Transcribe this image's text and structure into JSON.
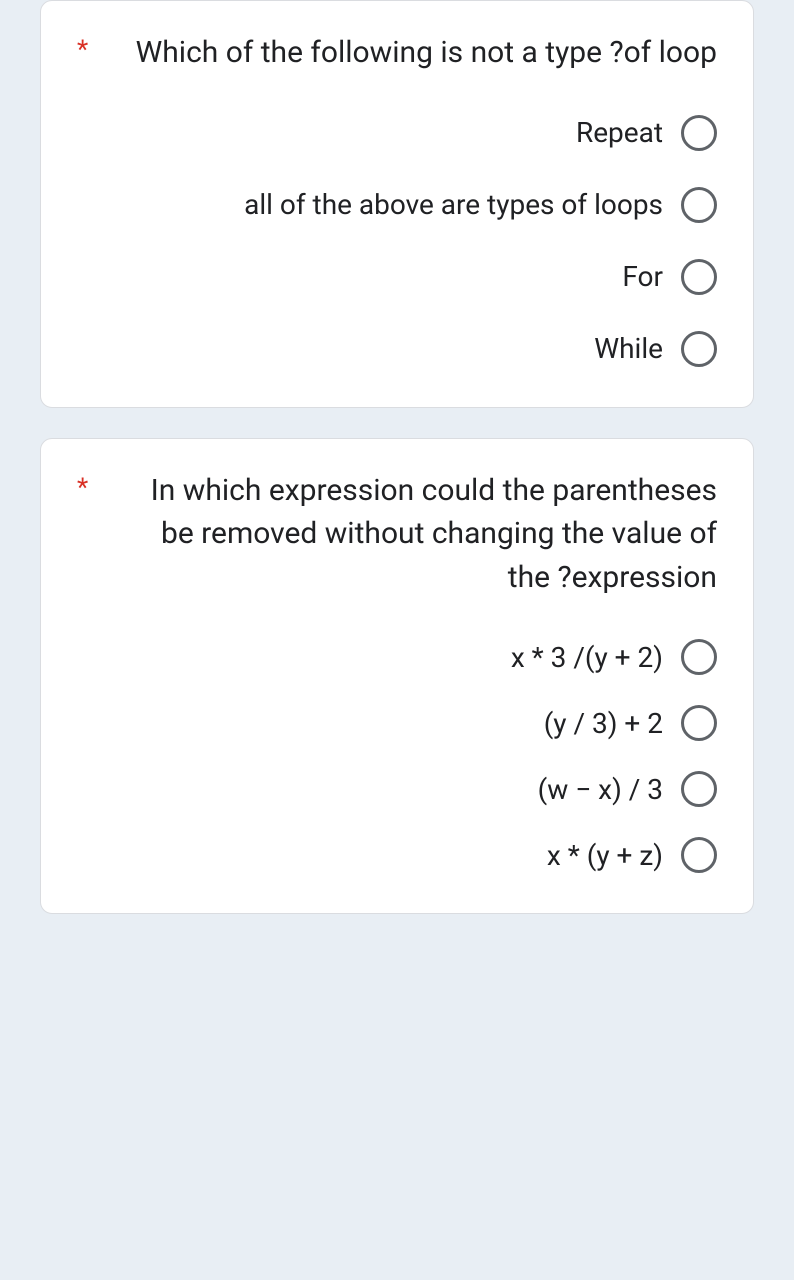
{
  "required_marker": "*",
  "questions": [
    {
      "text": "Which of the following is not a type ?of loop",
      "options": [
        "Repeat",
        "all of the above are types of loops",
        "For",
        "While"
      ]
    },
    {
      "text": "In which expression could the parentheses be removed without changing the value of the ?expression",
      "options": [
        "x * 3 /(y + 2)",
        "(y / 3) + 2",
        "(w − x) / 3",
        "x * (y + z)"
      ]
    }
  ]
}
